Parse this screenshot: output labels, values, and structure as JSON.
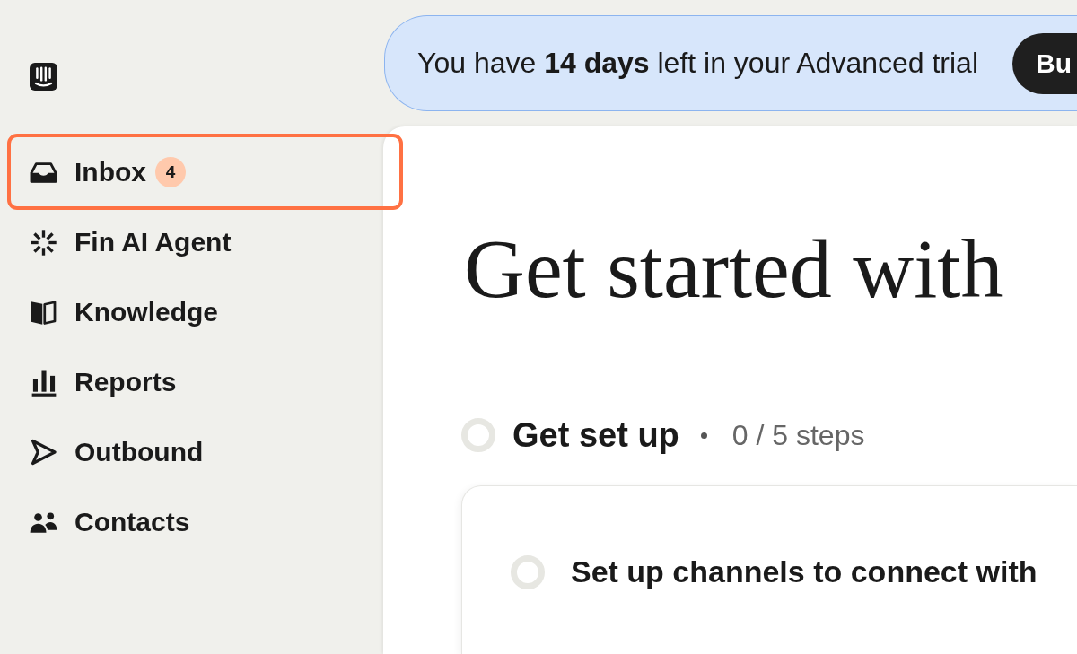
{
  "sidebar": {
    "items": [
      {
        "label": "Inbox",
        "badge": "4",
        "highlighted": true
      },
      {
        "label": "Fin AI Agent",
        "highlighted": false
      },
      {
        "label": "Knowledge",
        "highlighted": false
      },
      {
        "label": "Reports",
        "highlighted": false
      },
      {
        "label": "Outbound",
        "highlighted": false
      },
      {
        "label": "Contacts",
        "highlighted": false
      }
    ]
  },
  "banner": {
    "message": "You have **14 days** left in your Advanced trial",
    "button": "Bu"
  },
  "main": {
    "title": "Get started with",
    "section": {
      "title": "Get set up",
      "progress": "0 / 5 steps",
      "done": false,
      "steps": [
        {
          "title": "Set up channels to connect with",
          "done": false
        }
      ]
    }
  }
}
